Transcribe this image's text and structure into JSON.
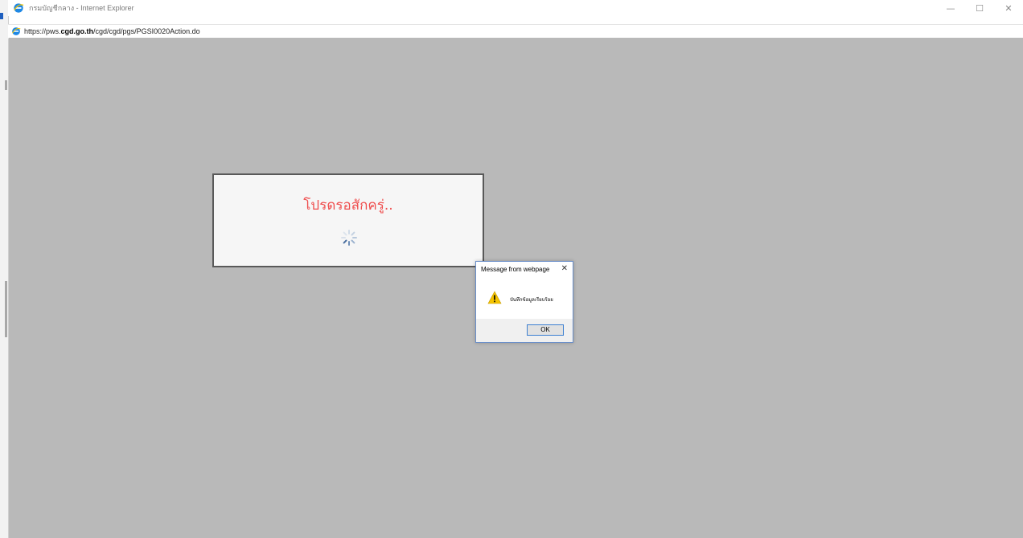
{
  "window": {
    "title": "กรมบัญชีกลาง - Internet Explorer",
    "controls": {
      "minimize": "—",
      "maximize": "☐",
      "close": "✕"
    }
  },
  "address_bar": {
    "url_prefix": "https://pws.",
    "url_domain": "cgd.go.th",
    "url_path": "/cgd/cgd/pgs/PGSI0020Action.do"
  },
  "loading": {
    "text": "โปรดรอสักครู่.."
  },
  "dialog": {
    "title": "Message from webpage",
    "close": "✕",
    "message": "บันทึกข้อมูลเรียบร้อย",
    "ok_label": "OK"
  },
  "colors": {
    "overlay": "#b9b9b9",
    "loading_text": "#ef4d4d",
    "ie_blue": "#1e88e5",
    "warning_yellow": "#f5c400"
  }
}
